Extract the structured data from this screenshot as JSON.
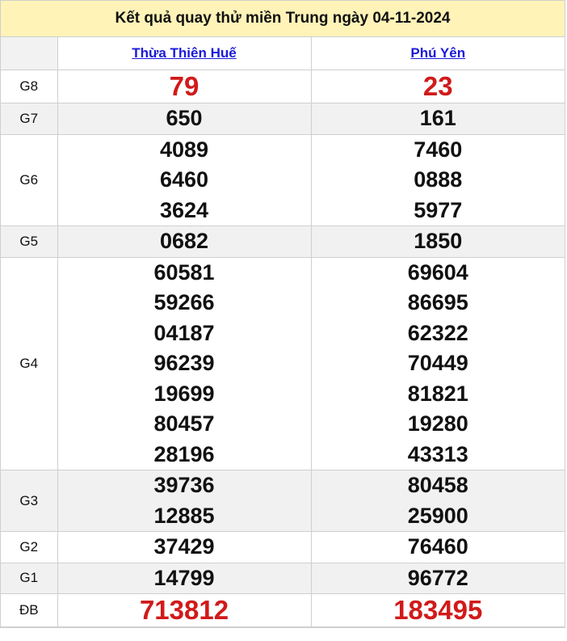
{
  "title": "Kết quả quay thử miền Trung ngày 04-11-2024",
  "provinces": [
    "Thừa Thiên Huế",
    "Phú Yên"
  ],
  "prizes": [
    {
      "label": "G8",
      "values": [
        [
          "79"
        ],
        [
          "23"
        ]
      ]
    },
    {
      "label": "G7",
      "values": [
        [
          "650"
        ],
        [
          "161"
        ]
      ]
    },
    {
      "label": "G6",
      "values": [
        [
          "4089",
          "6460",
          "3624"
        ],
        [
          "7460",
          "0888",
          "5977"
        ]
      ]
    },
    {
      "label": "G5",
      "values": [
        [
          "0682"
        ],
        [
          "1850"
        ]
      ]
    },
    {
      "label": "G4",
      "values": [
        [
          "60581",
          "59266",
          "04187",
          "96239",
          "19699",
          "80457",
          "28196"
        ],
        [
          "69604",
          "86695",
          "62322",
          "70449",
          "81821",
          "19280",
          "43313"
        ]
      ]
    },
    {
      "label": "G3",
      "values": [
        [
          "39736",
          "12885"
        ],
        [
          "80458",
          "25900"
        ]
      ]
    },
    {
      "label": "G2",
      "values": [
        [
          "37429"
        ],
        [
          "76460"
        ]
      ]
    },
    {
      "label": "G1",
      "values": [
        [
          "14799"
        ],
        [
          "96772"
        ]
      ]
    },
    {
      "label": "ĐB",
      "values": [
        [
          "713812"
        ],
        [
          "183495"
        ]
      ]
    }
  ],
  "colors": {
    "header_bg": "#fff3b8",
    "special_red": "#d11a1a",
    "link_blue": "#1a1adb",
    "alt_row_bg": "#f1f1f1"
  }
}
